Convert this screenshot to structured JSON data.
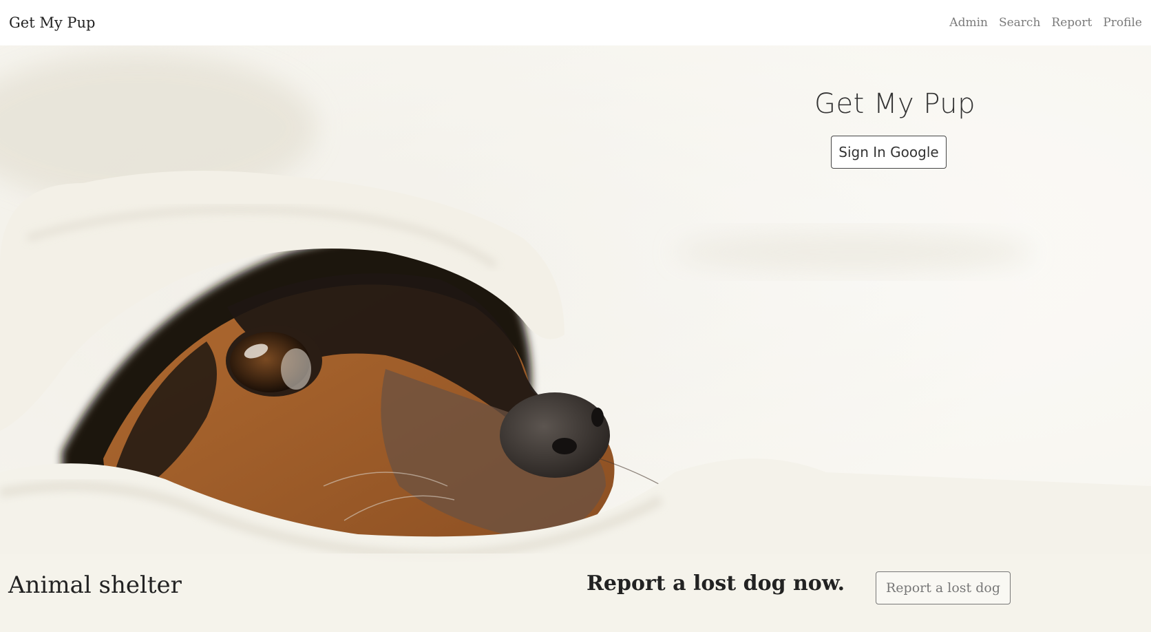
{
  "navbar": {
    "brand": "Get My Pup",
    "links": [
      "Admin",
      "Search",
      "Report",
      "Profile"
    ]
  },
  "hero": {
    "title": "Get My Pup",
    "signin_label": "Sign In Google",
    "photo_icon": "dog-under-blanket-photo"
  },
  "footer": {
    "shelter_title": "Animal shelter",
    "report_heading": "Report a lost dog now.",
    "report_button": "Report a lost dog"
  },
  "colors": {
    "text": "#222222",
    "muted": "#7a7a7a",
    "blanket": "#f3f1ea",
    "dog_black": "#1e1712",
    "dog_tan": "#a0612e"
  }
}
